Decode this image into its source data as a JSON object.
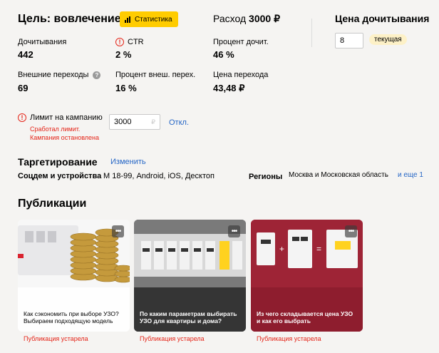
{
  "goal": {
    "title": "Цель: вовлечение",
    "stats_button": "Статистика"
  },
  "metrics": {
    "reads_label": "Дочитывания",
    "reads_value": "442",
    "ctr_label": "CTR",
    "ctr_value": "2 %",
    "ext_label": "Внешние переходы",
    "ext_value": "69",
    "ext_pct_label": "Процент внеш. перех.",
    "ext_pct_value": "16 %"
  },
  "spend": {
    "label": "Расход",
    "value": "3000 ₽",
    "read_pct_label": "Процент дочит.",
    "read_pct_value": "46 %",
    "click_price_label": "Цена перехода",
    "click_price_value": "43,48 ₽"
  },
  "read_price": {
    "title": "Цена дочитывания",
    "input_value": "8",
    "current_label": "текущая"
  },
  "limit": {
    "label": "Лимит на кампанию",
    "input_value": "3000",
    "currency": "₽",
    "off_link": "Откл.",
    "warning_line1": "Сработал лимит.",
    "warning_line2": "Кампания остановлена"
  },
  "targeting": {
    "title": "Таргетирование",
    "edit_link": "Изменить",
    "audience_label": "Соцдем и устройства",
    "audience_value": "М 18-99, Android, iOS, Десктоп",
    "regions_label": "Регионы",
    "regions_value": "Москва и Московская область",
    "regions_more": "и еще 1"
  },
  "publications": {
    "title": "Публикации",
    "items": [
      {
        "title": "Как сэкономить при выборе УЗО? Выбираем подходящую модель",
        "status": "Публикация устарела"
      },
      {
        "title": "По каким параметрам выбирать УЗО для квартиры и дома?",
        "status": "Публикация устарела"
      },
      {
        "title": "Из чего складывается цена УЗО и как его выбрать",
        "status": "Публикация устарела"
      }
    ]
  },
  "colors": {
    "accent_yellow": "#ffcc00",
    "link_blue": "#2566c6",
    "warning_red": "#e5261a",
    "card3_bg": "#9e2436"
  }
}
